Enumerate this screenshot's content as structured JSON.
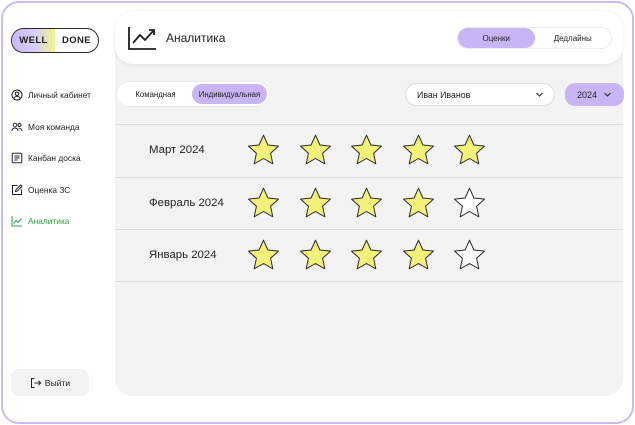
{
  "logo": {
    "left": "WELL",
    "right": "DONE"
  },
  "sidebar": {
    "items": [
      {
        "label": "Личный кабинет",
        "icon": "user-circle-icon",
        "active": false
      },
      {
        "label": "Моя команда",
        "icon": "team-icon",
        "active": false
      },
      {
        "label": "Канбан доска",
        "icon": "kanban-icon",
        "active": false
      },
      {
        "label": "Оценка ЗС",
        "icon": "edit-icon",
        "active": false
      },
      {
        "label": "Аналитика",
        "icon": "chart-icon",
        "active": true
      }
    ],
    "logout_label": "Выйти"
  },
  "header": {
    "title": "Аналитика",
    "tabs": [
      {
        "label": "Оценки",
        "active": true
      },
      {
        "label": "Дедлайны",
        "active": false
      }
    ]
  },
  "filters": {
    "mode_tabs": [
      {
        "label": "Командная",
        "active": false
      },
      {
        "label": "Индивидуальная",
        "active": true
      }
    ],
    "user": "Иван Иванов",
    "year": "2024"
  },
  "ratings": [
    {
      "month": "Март 2024",
      "stars": 5,
      "max": 5
    },
    {
      "month": "Февраль 2024",
      "stars": 4,
      "max": 5
    },
    {
      "month": "Январь 2024",
      "stars": 4,
      "max": 5
    }
  ],
  "colors": {
    "accent": "#c9b5f5",
    "star_fill": "#f4f17a",
    "active_nav": "#2f9e45",
    "frame_border": "#cbb9f2"
  }
}
